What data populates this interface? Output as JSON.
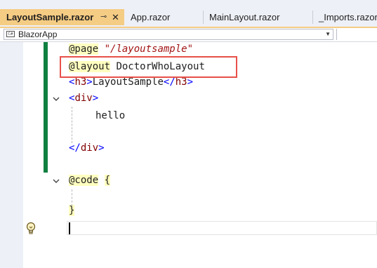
{
  "tabs": [
    {
      "label": "LayoutSample.razor",
      "active": true,
      "pin": "⊸",
      "close": "✕"
    },
    {
      "label": "App.razor",
      "active": false
    },
    {
      "label": "MainLayout.razor",
      "active": false
    },
    {
      "label": "_Imports.razor",
      "active": false
    }
  ],
  "navbar": {
    "project": "BlazorApp",
    "project_icon": "C#"
  },
  "code": {
    "line1_directive": "@page",
    "line1_string": "\"/layoutsample\"",
    "line2_directive": "@layout",
    "line2_value": "DoctorWhoLayout",
    "line3_open_lt": "<",
    "line3_open_tag": "h3",
    "line3_open_gt": ">",
    "line3_text": "LayoutSample",
    "line3_close_lt": "</",
    "line3_close_tag": "h3",
    "line3_close_gt": ">",
    "line4_lt": "<",
    "line4_tag": "div",
    "line4_gt": ">",
    "line5_text": "hello",
    "line7_lt": "</",
    "line7_tag": "div",
    "line7_gt": ">",
    "line9_directive": "@code",
    "line9_brace": "{",
    "line11_brace": "}"
  },
  "colors": {
    "active_tab": "#f5cc84",
    "change_bar": "#108040",
    "highlight_box": "#e8504a"
  },
  "icons": {
    "fold": "chevron-down-icon",
    "lightbulb": "lightbulb-icon"
  }
}
